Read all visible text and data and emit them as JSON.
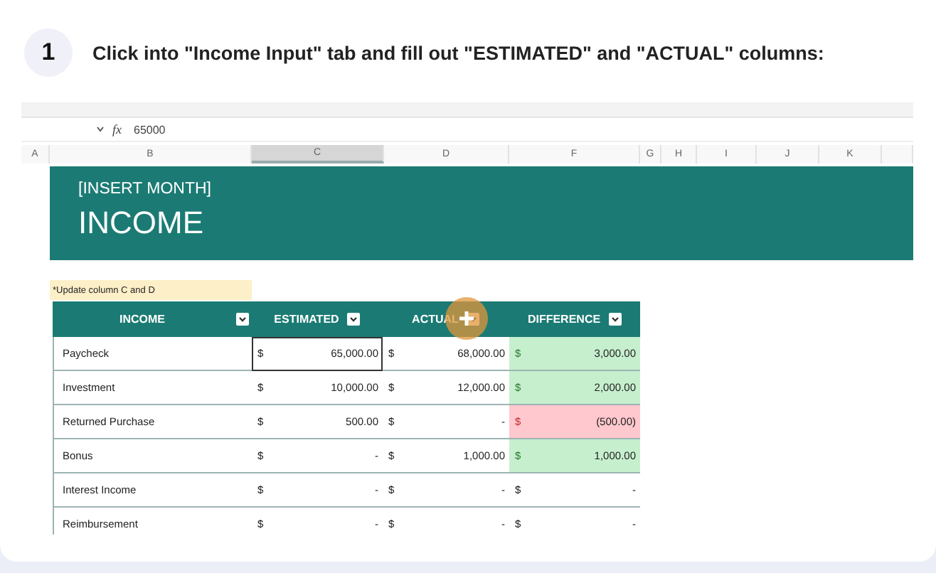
{
  "step": {
    "number": "1",
    "instruction": "Click into \"Income Input\" tab and fill out \"ESTIMATED\" and \"ACTUAL\" columns:"
  },
  "formula_bar": {
    "function_label": "fx",
    "value": "65000"
  },
  "column_headers": [
    {
      "label": "A",
      "selected": false
    },
    {
      "label": "B",
      "selected": false
    },
    {
      "label": "C",
      "selected": true
    },
    {
      "label": "D",
      "selected": false
    },
    {
      "label": "F",
      "selected": false
    },
    {
      "label": "G",
      "selected": false
    },
    {
      "label": "H",
      "selected": false
    },
    {
      "label": "I",
      "selected": false
    },
    {
      "label": "J",
      "selected": false
    },
    {
      "label": "K",
      "selected": false
    }
  ],
  "banner": {
    "subtitle": "[INSERT MONTH]",
    "title": "INCOME"
  },
  "note": "*Update column C and D",
  "table": {
    "columns": [
      "INCOME",
      "ESTIMATED",
      "ACTUAL",
      "DIFFERENCE"
    ],
    "rows": [
      {
        "name": "Paycheck",
        "estimated": {
          "symbol": "$",
          "amount": "65,000.00"
        },
        "actual": {
          "symbol": "$",
          "amount": "68,000.00"
        },
        "difference": {
          "symbol": "$",
          "amount": "3,000.00"
        },
        "color": "#c6efce",
        "estimated_selected": true
      },
      {
        "name": "Investment",
        "estimated": {
          "symbol": "$",
          "amount": "10,000.00"
        },
        "actual": {
          "symbol": "$",
          "amount": "12,000.00"
        },
        "difference": {
          "symbol": "$",
          "amount": "2,000.00"
        },
        "color": "#c6efce",
        "estimated_selected": false
      },
      {
        "name": "Returned Purchase",
        "estimated": {
          "symbol": "$",
          "amount": "500.00"
        },
        "actual": {
          "symbol": "$",
          "amount": "-"
        },
        "difference": {
          "symbol": "$",
          "amount": "(500.00)"
        },
        "color": "#ffc7ce",
        "estimated_selected": false
      },
      {
        "name": "Bonus",
        "estimated": {
          "symbol": "$",
          "amount": "-"
        },
        "actual": {
          "symbol": "$",
          "amount": "1,000.00"
        },
        "difference": {
          "symbol": "$",
          "amount": "1,000.00"
        },
        "color": "#c6efce",
        "estimated_selected": false
      },
      {
        "name": "Interest Income",
        "estimated": {
          "symbol": "$",
          "amount": "-"
        },
        "actual": {
          "symbol": "$",
          "amount": "-"
        },
        "difference": {
          "symbol": "$",
          "amount": "-"
        },
        "color": "#ffffff",
        "estimated_selected": false
      },
      {
        "name": "Reimbursement",
        "estimated": {
          "symbol": "$",
          "amount": "-"
        },
        "actual": {
          "symbol": "$",
          "amount": "-"
        },
        "difference": {
          "symbol": "$",
          "amount": "-"
        },
        "color": "#ffffff",
        "estimated_selected": false
      }
    ]
  }
}
